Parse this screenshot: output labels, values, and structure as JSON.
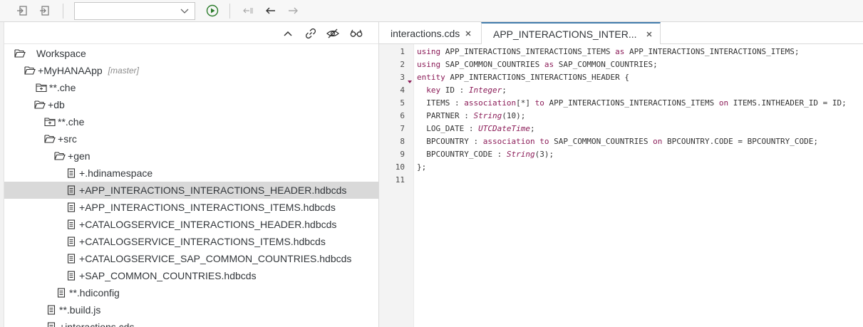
{
  "toolbar": {
    "icons": [
      "import-icon",
      "export-icon",
      "run-icon",
      "back-list-icon",
      "back-icon",
      "forward-icon"
    ],
    "run_color": "#2b7c2b",
    "selected_config": ""
  },
  "tree_tools": {
    "icons": [
      "collapse-icon",
      "link-icon",
      "hide-icon",
      "glasses-icon"
    ]
  },
  "tree": [
    {
      "prefix": "",
      "label": "Workspace",
      "branch": "",
      "icon": "folder-open-icon"
    },
    {
      "prefix": "+",
      "label": "MyHANAApp",
      "branch": "[master]",
      "icon": "folder-open-icon"
    },
    {
      "prefix": "**",
      "label": ".che",
      "branch": "",
      "icon": "folder-closed-icon"
    },
    {
      "prefix": "+",
      "label": "db",
      "branch": "",
      "icon": "folder-open-icon"
    },
    {
      "prefix": "**",
      "label": ".che",
      "branch": "",
      "icon": "folder-closed-icon"
    },
    {
      "prefix": "+",
      "label": "src",
      "branch": "",
      "icon": "folder-open-icon"
    },
    {
      "prefix": "+",
      "label": "gen",
      "branch": "",
      "icon": "folder-open-icon"
    },
    {
      "prefix": "+",
      "label": ".hdinamespace",
      "branch": "",
      "icon": "file-icon"
    },
    {
      "prefix": "+",
      "label": "APP_INTERACTIONS_INTERACTIONS_HEADER.hdbcds",
      "branch": "",
      "icon": "file-icon"
    },
    {
      "prefix": "+",
      "label": "APP_INTERACTIONS_INTERACTIONS_ITEMS.hdbcds",
      "branch": "",
      "icon": "file-icon"
    },
    {
      "prefix": "+",
      "label": "CATALOGSERVICE_INTERACTIONS_HEADER.hdbcds",
      "branch": "",
      "icon": "file-icon"
    },
    {
      "prefix": "+",
      "label": "CATALOGSERVICE_INTERACTIONS_ITEMS.hdbcds",
      "branch": "",
      "icon": "file-icon"
    },
    {
      "prefix": "+",
      "label": "CATALOGSERVICE_SAP_COMMON_COUNTRIES.hdbcds",
      "branch": "",
      "icon": "file-icon"
    },
    {
      "prefix": "+",
      "label": "SAP_COMMON_COUNTRIES.hdbcds",
      "branch": "",
      "icon": "file-icon"
    },
    {
      "prefix": "**",
      "label": ".hdiconfig",
      "branch": "",
      "icon": "file-icon"
    },
    {
      "prefix": "**",
      "label": ".build.js",
      "branch": "",
      "icon": "file-icon"
    },
    {
      "prefix": "+",
      "label": "interactions.cds",
      "branch": "",
      "icon": "file-icon"
    }
  ],
  "selected_tree_item": "APP_INTERACTIONS_INTERACTIONS_HEADER.hdbcds",
  "tabs": [
    {
      "title": "interactions.cds"
    },
    {
      "title": "APP_INTERACTIONS_INTER..."
    }
  ],
  "editor": {
    "line_numbers": [
      "1",
      "2",
      "3",
      "4",
      "5",
      "6",
      "7",
      "8",
      "9",
      "10",
      "11"
    ],
    "lines": [
      [
        {
          "t": "using",
          "c": "kw"
        },
        {
          "t": " APP_INTERACTIONS_INTERACTIONS_ITEMS ",
          "c": "pl"
        },
        {
          "t": "as",
          "c": "kw"
        },
        {
          "t": " APP_INTERACTIONS_INTERACTIONS_ITEMS;",
          "c": "pl"
        }
      ],
      [
        {
          "t": "using",
          "c": "kw"
        },
        {
          "t": " SAP_COMMON_COUNTRIES ",
          "c": "pl"
        },
        {
          "t": "as",
          "c": "kw"
        },
        {
          "t": " SAP_COMMON_COUNTRIES;",
          "c": "pl"
        }
      ],
      [
        {
          "t": "entity",
          "c": "kw"
        },
        {
          "t": " APP_INTERACTIONS_INTERACTIONS_HEADER {",
          "c": "pl"
        }
      ],
      [
        {
          "t": "  ",
          "c": "pl"
        },
        {
          "t": "key",
          "c": "kw"
        },
        {
          "t": " ID : ",
          "c": "pl"
        },
        {
          "t": "Integer",
          "c": "ty"
        },
        {
          "t": ";",
          "c": "pl"
        }
      ],
      [
        {
          "t": "  ITEMS : ",
          "c": "pl"
        },
        {
          "t": "association",
          "c": "kw"
        },
        {
          "t": "[*] ",
          "c": "pl"
        },
        {
          "t": "to",
          "c": "kw"
        },
        {
          "t": " APP_INTERACTIONS_INTERACTIONS_ITEMS ",
          "c": "pl"
        },
        {
          "t": "on",
          "c": "kw"
        },
        {
          "t": " ITEMS.INTHEADER_ID = ID;",
          "c": "pl"
        }
      ],
      [
        {
          "t": "  PARTNER : ",
          "c": "pl"
        },
        {
          "t": "String",
          "c": "ty"
        },
        {
          "t": "(10);",
          "c": "pl"
        }
      ],
      [
        {
          "t": "  LOG_DATE : ",
          "c": "pl"
        },
        {
          "t": "UTCDateTime",
          "c": "ty"
        },
        {
          "t": ";",
          "c": "pl"
        }
      ],
      [
        {
          "t": "  BPCOUNTRY : ",
          "c": "pl"
        },
        {
          "t": "association",
          "c": "kw"
        },
        {
          "t": " ",
          "c": "pl"
        },
        {
          "t": "to",
          "c": "kw"
        },
        {
          "t": " SAP_COMMON_COUNTRIES ",
          "c": "pl"
        },
        {
          "t": "on",
          "c": "kw"
        },
        {
          "t": " BPCOUNTRY.CODE = BPCOUNTRY_CODE;",
          "c": "pl"
        }
      ],
      [
        {
          "t": "  BPCOUNTRY_CODE : ",
          "c": "pl"
        },
        {
          "t": "String",
          "c": "ty"
        },
        {
          "t": "(3);",
          "c": "pl"
        }
      ],
      [
        {
          "t": "};",
          "c": "pl"
        }
      ],
      []
    ]
  },
  "colors": {
    "keyword": "#8b1c58",
    "active_tab_accent": "#427cac",
    "selection": "#d9d9d9"
  }
}
